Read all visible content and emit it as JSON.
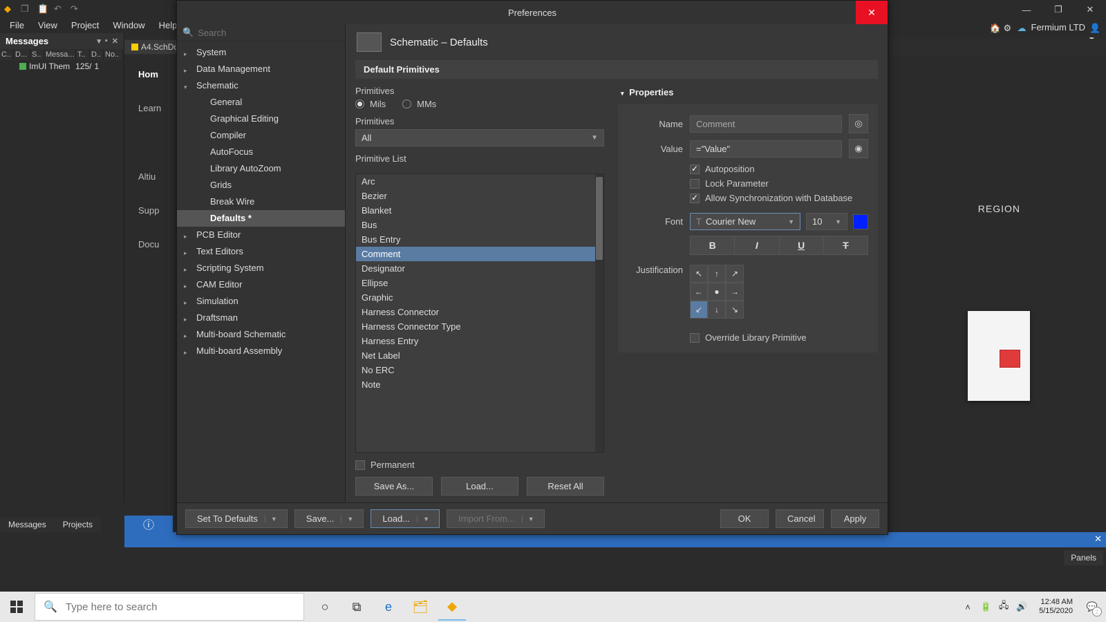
{
  "app": {
    "menus": [
      "File",
      "View",
      "Project",
      "Window",
      "Help"
    ],
    "branding": "Fermium LTD"
  },
  "messages_panel": {
    "title": "Messages",
    "columns": [
      "C..",
      "D...",
      "S..",
      "Messa...",
      "T..",
      "D..",
      "No.."
    ],
    "row": {
      "text": "ImUI Them",
      "num1": "125/",
      "num2": "1"
    }
  },
  "doc_tab": "A4.SchDo",
  "side_nav": [
    "Hom",
    "Learn",
    "Altiu",
    "Supp",
    "Docu"
  ],
  "bottom_tabs": [
    "Messages",
    "Projects"
  ],
  "panels_btn": "Panels",
  "region_label": "REGION",
  "dialog": {
    "title": "Preferences",
    "search_placeholder": "Search",
    "tree": {
      "top": [
        {
          "label": "System",
          "expanded": false
        },
        {
          "label": "Data Management",
          "expanded": false
        },
        {
          "label": "Schematic",
          "expanded": true,
          "children": [
            "General",
            "Graphical Editing",
            "Compiler",
            "AutoFocus",
            "Library AutoZoom",
            "Grids",
            "Break Wire",
            {
              "label": "Defaults *",
              "selected": true
            }
          ]
        },
        {
          "label": "PCB Editor",
          "expanded": false
        },
        {
          "label": "Text Editors",
          "expanded": false
        },
        {
          "label": "Scripting System",
          "expanded": false
        },
        {
          "label": "CAM Editor",
          "expanded": false
        },
        {
          "label": "Simulation",
          "expanded": false
        },
        {
          "label": "Draftsman",
          "expanded": false
        },
        {
          "label": "Multi-board Schematic",
          "expanded": false
        },
        {
          "label": "Multi-board Assembly",
          "expanded": false
        }
      ]
    },
    "content": {
      "title": "Schematic – Defaults",
      "section": "Default Primitives",
      "primitives_label": "Primitives",
      "units": {
        "mils": "Mils",
        "mms": "MMs",
        "selected": "mils"
      },
      "primitives_select_label": "Primitives",
      "primitives_select_value": "All",
      "list_label": "Primitive List",
      "list_items": [
        "Arc",
        "Bezier",
        "Blanket",
        "Bus",
        "Bus Entry",
        "Comment",
        "Designator",
        "Ellipse",
        "Graphic",
        "Harness Connector",
        "Harness Connector Type",
        "Harness Entry",
        "Net Label",
        "No ERC",
        "Note"
      ],
      "list_selected": "Comment",
      "permanent": "Permanent",
      "buttons": {
        "save_as": "Save As...",
        "load": "Load...",
        "reset_all": "Reset All"
      }
    },
    "properties": {
      "header": "Properties",
      "name_label": "Name",
      "name_placeholder": "Comment",
      "value_label": "Value",
      "value_text": "=\"Value\"",
      "checks": {
        "autoposition": {
          "label": "Autoposition",
          "checked": true
        },
        "lock_parameter": {
          "label": "Lock Parameter",
          "checked": false
        },
        "allow_sync": {
          "label": "Allow Synchronization with Database",
          "checked": true
        }
      },
      "font_label": "Font",
      "font_name": "Courier New",
      "font_size": "10",
      "font_color": "#0020ff",
      "styles": {
        "bold": "B",
        "italic": "I",
        "underline": "U",
        "strike": "T"
      },
      "justification_label": "Justification",
      "justification_selected": "bottom-left",
      "override": {
        "label": "Override Library Primitive",
        "checked": false
      }
    },
    "footer": {
      "set_defaults": "Set To Defaults",
      "save": "Save...",
      "load": "Load...",
      "import_from": "Import From...",
      "ok": "OK",
      "cancel": "Cancel",
      "apply": "Apply"
    }
  },
  "taskbar": {
    "search_placeholder": "Type here to search",
    "time": "12:48 AM",
    "date": "5/15/2020",
    "notif_count": "2"
  }
}
